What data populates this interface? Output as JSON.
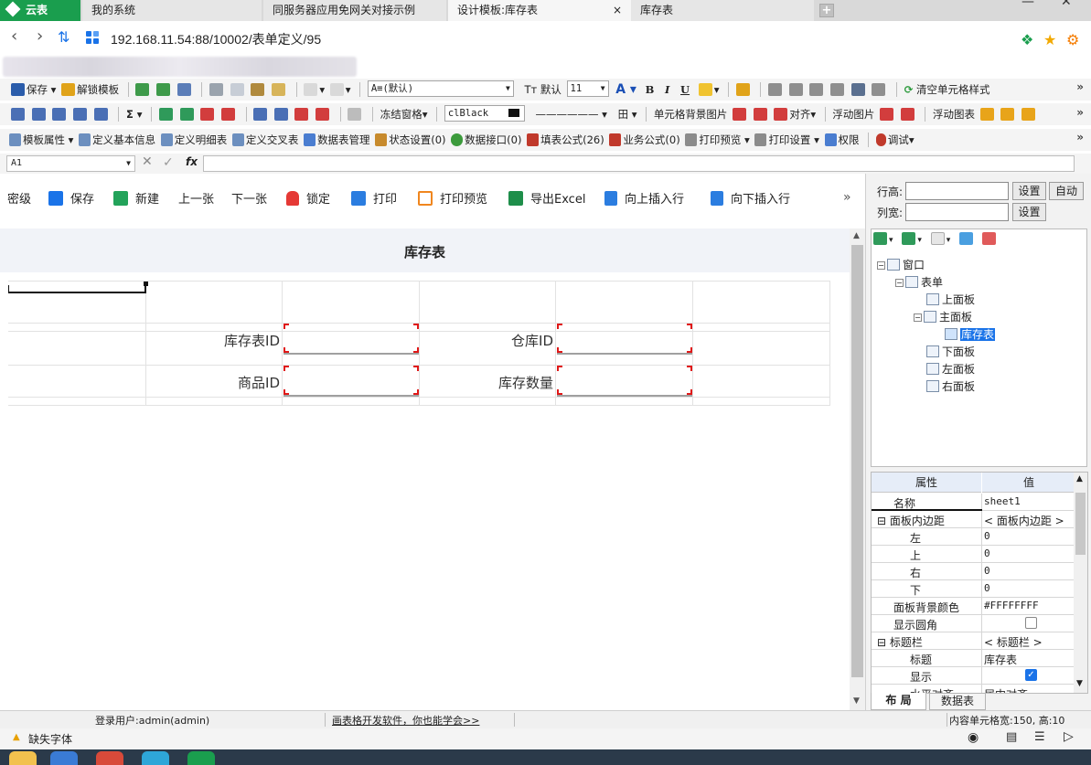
{
  "browser": {
    "brand": "云表",
    "tabs": [
      {
        "label": "我的系统"
      },
      {
        "label": "同服务器应用免网关对接示例"
      },
      {
        "label": "设计模板:库存表"
      },
      {
        "label": "库存表"
      }
    ],
    "active_tab_close": "×",
    "new_tab": "+",
    "url": "192.168.11.54:88/10002/表单定义/95",
    "window_controls": [
      "—",
      "✕"
    ]
  },
  "toolbar1": {
    "save": "保存",
    "unlock_template": "解锁模板",
    "font_combo": "A≡(默认)",
    "size_prefix": "Tт 默认",
    "font_size": "11",
    "bold": "B",
    "italic": "I",
    "underline": "U",
    "clear_cell_style": "清空单元格样式"
  },
  "toolbar2": {
    "sigma": "Σ",
    "freeze_panes": "冻结窗格",
    "color_combo": "clBlack",
    "cell_bg_image": "单元格背景图片",
    "align": "对齐",
    "float_image": "浮动图片",
    "float_chart": "浮动图表"
  },
  "toolbar3": {
    "items": [
      {
        "label": "模板属性",
        "dropdown": true
      },
      {
        "label": "定义基本信息"
      },
      {
        "label": "定义明细表"
      },
      {
        "label": "定义交叉表"
      },
      {
        "label": "数据表管理"
      },
      {
        "label": "状态设置(0)"
      },
      {
        "label": "数据接口(0)"
      },
      {
        "label": "填表公式(26)"
      },
      {
        "label": "业务公式(0)"
      },
      {
        "label": "打印预览",
        "dropdown": true
      },
      {
        "label": "打印设置",
        "dropdown": true
      },
      {
        "label": "权限"
      },
      {
        "label": "调试",
        "dropdown": true
      }
    ]
  },
  "formula_bar": {
    "cell_ref": "A1",
    "cancel": "✕",
    "confirm": "✓",
    "fx": "fx",
    "value": ""
  },
  "action_bar": {
    "items": [
      {
        "label": "密级"
      },
      {
        "label": "保存"
      },
      {
        "label": "新建"
      },
      {
        "label": "上一张"
      },
      {
        "label": "下一张"
      },
      {
        "label": "锁定"
      },
      {
        "label": "打印"
      },
      {
        "label": "打印预览"
      },
      {
        "label": "导出Excel"
      },
      {
        "label": "向上插入行"
      },
      {
        "label": "向下插入行"
      }
    ],
    "more": "»"
  },
  "form": {
    "title": "库存表",
    "labels": {
      "inventory_id": "库存表ID",
      "warehouse_id": "仓库ID",
      "product_id": "商品ID",
      "stock_qty": "库存数量"
    }
  },
  "right_panel": {
    "row_height_label": "行高:",
    "col_width_label": "列宽:",
    "set_label": "设置",
    "auto_label": "自动",
    "tree": [
      {
        "label": "窗口",
        "toggle": "⊟"
      },
      {
        "label": "表单",
        "toggle": "⊟"
      },
      {
        "label": "上面板"
      },
      {
        "label": "主面板",
        "toggle": "⊟"
      },
      {
        "label": "库存表",
        "selected": true
      },
      {
        "label": "下面板"
      },
      {
        "label": "左面板"
      },
      {
        "label": "右面板"
      }
    ],
    "props_header": {
      "prop": "属性",
      "value": "值"
    },
    "props": [
      {
        "key": "名称",
        "value": "sheet1"
      },
      {
        "key": "面板内边距",
        "value": "< 面板内边距 >",
        "group": true
      },
      {
        "key": "左",
        "value": "0"
      },
      {
        "key": "上",
        "value": "0"
      },
      {
        "key": "右",
        "value": "0"
      },
      {
        "key": "下",
        "value": "0"
      },
      {
        "key": "面板背景颜色",
        "value": "#FFFFFFFF"
      },
      {
        "key": "显示圆角",
        "value": ""
      },
      {
        "key": "标题栏",
        "value": "< 标题栏 >",
        "group": true
      },
      {
        "key": "标题",
        "value": "库存表"
      },
      {
        "key": "显示",
        "value": ""
      },
      {
        "key": "水平对齐",
        "value": "居中对齐"
      }
    ],
    "bottom_tabs": [
      {
        "label": "布 局"
      },
      {
        "label": "数据表"
      }
    ]
  },
  "status_bar": {
    "login_user": "登录用户:admin(admin)",
    "slogan": "画表格开发软件，你也能学会>>",
    "cell_info": "内容单元格宽:150, 高:10"
  },
  "status_bar2": {
    "missing_font": "缺失字体"
  },
  "colors": {
    "brand_green": "#1a9e4e",
    "accent_blue": "#1a73e8",
    "field_corner_red": "#e01818"
  }
}
